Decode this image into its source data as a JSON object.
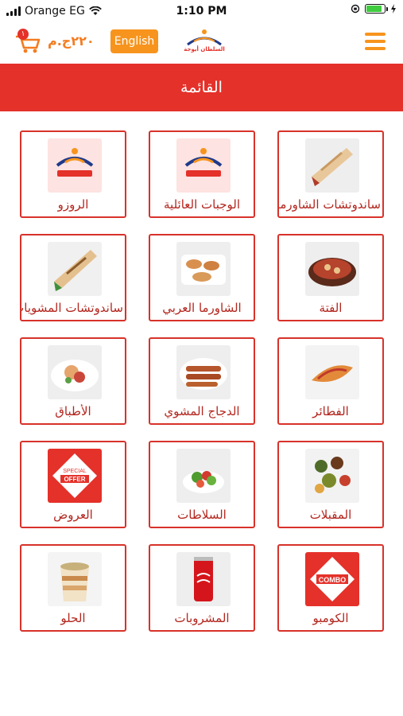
{
  "status_bar": {
    "carrier": "Orange EG",
    "time": "1:10 PM"
  },
  "header": {
    "cart_count": "١",
    "price": "٢٢٠ج.م",
    "language_button": "English",
    "logo_text": "السلطان أيوجة"
  },
  "page_title": "القائمة",
  "colors": {
    "brand_red": "#e4312a",
    "accent_orange": "#f7941d",
    "tile_border": "#d8322a"
  },
  "categories": [
    {
      "label": "ساندوتشات الشاورما",
      "icon": "shawarma-wrap"
    },
    {
      "label": "الوجبات العائلية",
      "icon": "sultan-logo"
    },
    {
      "label": "الروزو",
      "icon": "sultan-logo"
    },
    {
      "label": "الفتة",
      "icon": "fatta-plate"
    },
    {
      "label": "الشاورما العربي",
      "icon": "arabic-shawarma-plate"
    },
    {
      "label": "ساندوتشات المشويات",
      "icon": "grill-wrap"
    },
    {
      "label": "الفطائر",
      "icon": "pie-plate"
    },
    {
      "label": "الدجاج المشوي",
      "icon": "grilled-chicken-plate"
    },
    {
      "label": "الأطباق",
      "icon": "dish-plate"
    },
    {
      "label": "المقبلات",
      "icon": "appetizers-plate"
    },
    {
      "label": "السلاطات",
      "icon": "salad-bowl"
    },
    {
      "label": "العروض",
      "icon": "special-offer-tag"
    },
    {
      "label": "الكومبو",
      "icon": "combo-tag"
    },
    {
      "label": "المشروبات",
      "icon": "cola-can"
    },
    {
      "label": "الحلو",
      "icon": "dessert-cup"
    }
  ]
}
